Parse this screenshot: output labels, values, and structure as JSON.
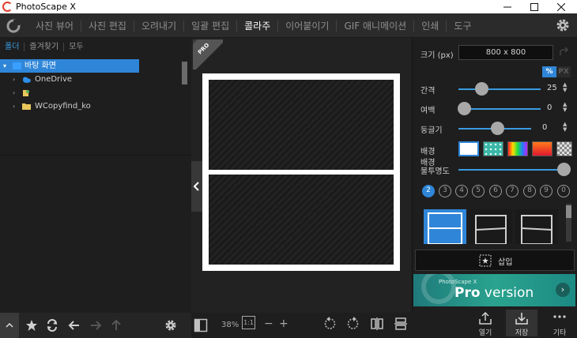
{
  "window": {
    "title": "PhotoScape X",
    "minimize_icon": "minimize-icon",
    "maximize_icon": "maximize-icon",
    "close_icon": "close-icon"
  },
  "menu": {
    "items": [
      {
        "label": "사진 뷰어",
        "active": false
      },
      {
        "label": "사진 편집",
        "active": false
      },
      {
        "label": "오려내기",
        "active": false
      },
      {
        "label": "일괄 편집",
        "active": false
      },
      {
        "label": "콜라주",
        "active": true
      },
      {
        "label": "이어붙이기",
        "active": false
      },
      {
        "label": "GIF 애니메이션",
        "active": false
      },
      {
        "label": "인쇄",
        "active": false
      },
      {
        "label": "도구",
        "active": false
      }
    ]
  },
  "left_panel": {
    "tabs": [
      {
        "label": "폴더",
        "active": true
      },
      {
        "label": "즐겨찾기",
        "active": false
      },
      {
        "label": "모두",
        "active": false
      }
    ],
    "tree": [
      {
        "label": "바탕 화면",
        "selected": true,
        "icon": "desktop-folder-icon"
      },
      {
        "label": "OneDrive",
        "selected": false,
        "icon": "onedrive-icon"
      },
      {
        "label": "",
        "selected": false,
        "icon": "user-folder-icon"
      },
      {
        "label": "WCopyfind_ko",
        "selected": false,
        "icon": "folder-icon"
      }
    ]
  },
  "pro_badge": "PRO",
  "canvas": {
    "zoom": "38%",
    "actual_size": "1:1",
    "zoom_out": "−",
    "zoom_in": "+"
  },
  "right_panel": {
    "size_label": "크기 (px)",
    "size_value": "800 x 800",
    "unit_percent": "%",
    "unit_px": "PX",
    "spacing_label": "간격",
    "spacing_value": "25",
    "margin_label": "여백",
    "margin_value": "0",
    "round_label": "둥글기",
    "round_value": "0",
    "background_label": "배경",
    "opacity_label": "배경\n불투명도",
    "opacity_line1": "배경",
    "opacity_line2": "불투명도",
    "photo_counts": [
      "2",
      "3",
      "4",
      "5",
      "6",
      "7",
      "8",
      "9",
      "0"
    ],
    "active_count": "2",
    "insert_label": "삽입",
    "promo_small": "PhotoScape X",
    "promo_big_a": "Pro",
    "promo_big_b": " version"
  },
  "bottom_buttons": {
    "open": "열기",
    "save": "저장",
    "more": "기타"
  },
  "colors": {
    "accent": "#2f86d8",
    "swatches": [
      "#ffffff",
      "#3bb7a8",
      "rainbow",
      "#e23a2a",
      "checker"
    ]
  }
}
